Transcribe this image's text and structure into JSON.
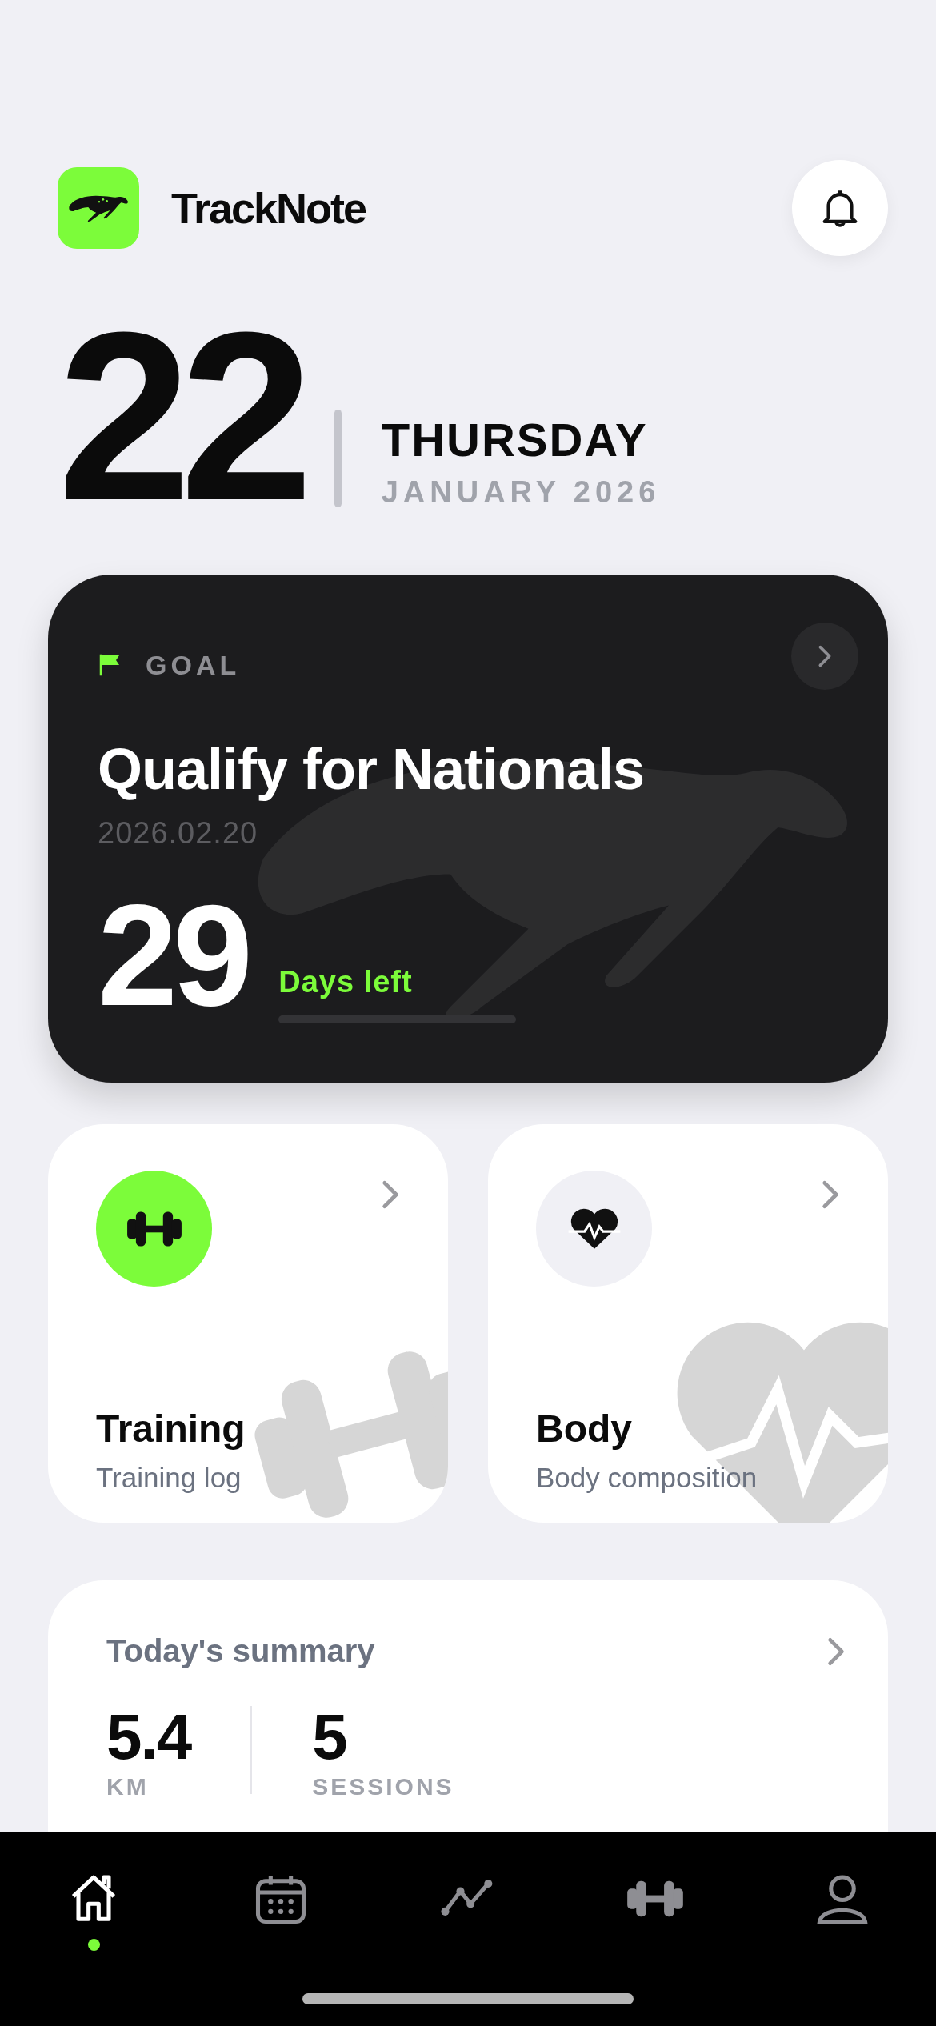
{
  "header": {
    "app_name": "TrackNote"
  },
  "date": {
    "day": "22",
    "weekday": "THURSDAY",
    "month_year": "JANUARY 2026"
  },
  "goal": {
    "label": "GOAL",
    "title": "Qualify for Nationals",
    "date": "2026.02.20",
    "days": "29",
    "days_caption": "Days left"
  },
  "tiles": [
    {
      "kind": "training",
      "title": "Training",
      "subtitle": "Training log",
      "color": "#7cfc3a"
    },
    {
      "kind": "body",
      "title": "Body",
      "subtitle": "Body composition",
      "color": "#f0f0f5"
    }
  ],
  "summary": {
    "title": "Today's summary",
    "stats": [
      {
        "value": "5.4",
        "unit": "KM"
      },
      {
        "value": "5",
        "unit": "SESSIONS"
      }
    ]
  },
  "tab_bar": {
    "items": [
      {
        "kind": "home",
        "selected": true
      },
      {
        "kind": "calendar",
        "selected": false
      },
      {
        "kind": "stats",
        "selected": false
      },
      {
        "kind": "workout",
        "selected": false
      },
      {
        "kind": "profile",
        "selected": false
      }
    ]
  }
}
